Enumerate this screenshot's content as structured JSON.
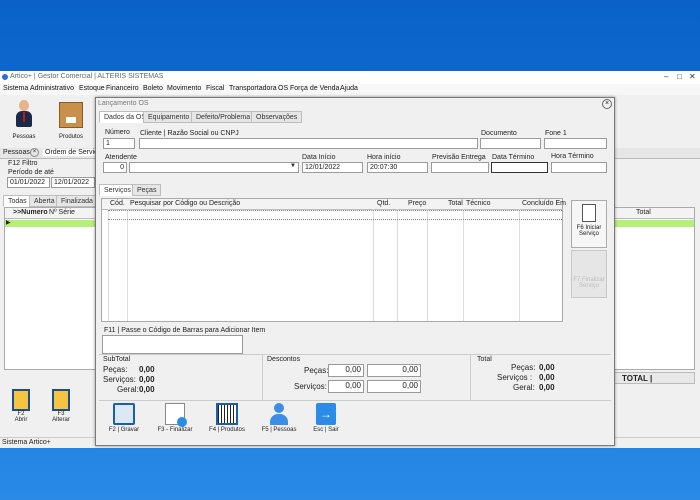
{
  "window": {
    "title": "Artico+ | Gestor Comercial | ALTERIS SISTEMAS",
    "status_text": "Sistema Artico+"
  },
  "menu": [
    "Sistema",
    "Administrativo",
    "Estoque",
    "Financeiro",
    "Boleto",
    "Movimento",
    "Fiscal",
    "Transportadora",
    "OS",
    "Força de Venda",
    "Ajuda"
  ],
  "toolbar": {
    "pessoas": "Pessoas",
    "produtos": "Produtos"
  },
  "background_panel": {
    "tab_pessoas": "Pessoas",
    "tab_os": "Ordem de Serviço",
    "filter_label": "F12 Filtro",
    "period_label": "Período de até",
    "date_from": "01/01/2022",
    "date_to": "12/01/2022",
    "status_tabs": [
      "Todas",
      "Aberta",
      "Finalizada"
    ],
    "grid_headers": {
      "numero": ">>Numero",
      "serie": "Nº Série",
      "total": "Total"
    },
    "total_label": "TOTAL |",
    "btn_abrir": "F2\nAbrir",
    "btn_alterar": "F3\nAlterar"
  },
  "dialog": {
    "title": "Lançamento OS",
    "tabs": [
      "Dados da OS",
      "Equipamento",
      "Defeito/Problema",
      "Observações"
    ],
    "fields": {
      "numero_label": "Número",
      "numero_value": "1",
      "cliente_label": "Cliente | Razão Social ou CNPJ",
      "cliente_value": "",
      "documento_label": "Documento",
      "documento_value": "",
      "fone_label": "Fone 1",
      "fone_value": "",
      "atendente_label": "Atendente",
      "atendente_code": "0",
      "atendente_value": "",
      "data_inicio_label": "Data Início",
      "data_inicio_value": "12/01/2022",
      "hora_inicio_label": "Hora início",
      "hora_inicio_value": "20:07:30",
      "previsao_label": "Previsão Entrega",
      "previsao_value": "",
      "data_termino_label": "Data Término",
      "data_termino_value": "",
      "hora_termino_label": "Hora Término",
      "hora_termino_value": ""
    },
    "subtabs": [
      "Serviços",
      "Peças"
    ],
    "grid_headers": [
      "Cód.",
      "Pesquisar por Código ou Descrição",
      "Qtd.",
      "Preço",
      "Total",
      "Técnico",
      "Concluído Em"
    ],
    "side_buttons": {
      "iniciar": "F6 Iniciar Serviço",
      "finalizar": "F7 Finalizar Serviço"
    },
    "barcode_label": "F11 | Passe o Código de Barras para Adicionar Item",
    "subtotal": {
      "title": "SubTotal",
      "pecas_label": "Peças:",
      "pecas": "0,00",
      "servicos_label": "Serviços:",
      "servicos": "0,00",
      "geral_label": "Geral:",
      "geral": "0,00"
    },
    "descontos": {
      "title": "Descontos",
      "pecas_label": "Peças:",
      "pecas_a": "0,00",
      "pecas_b": "0,00",
      "servicos_label": "Serviços:",
      "servicos_a": "0,00",
      "servicos_b": "0,00"
    },
    "total": {
      "title": "Total",
      "pecas_label": "Peças:",
      "pecas": "0,00",
      "servicos_label": "Serviços :",
      "servicos": "0,00",
      "geral_label": "Geral:",
      "geral": "0,00"
    },
    "bottom_buttons": [
      "F2 | Gravar",
      "F3 - Finalizar",
      "F4 | Produtos",
      "F5 | Pessoas",
      "Esc | Sair"
    ]
  }
}
